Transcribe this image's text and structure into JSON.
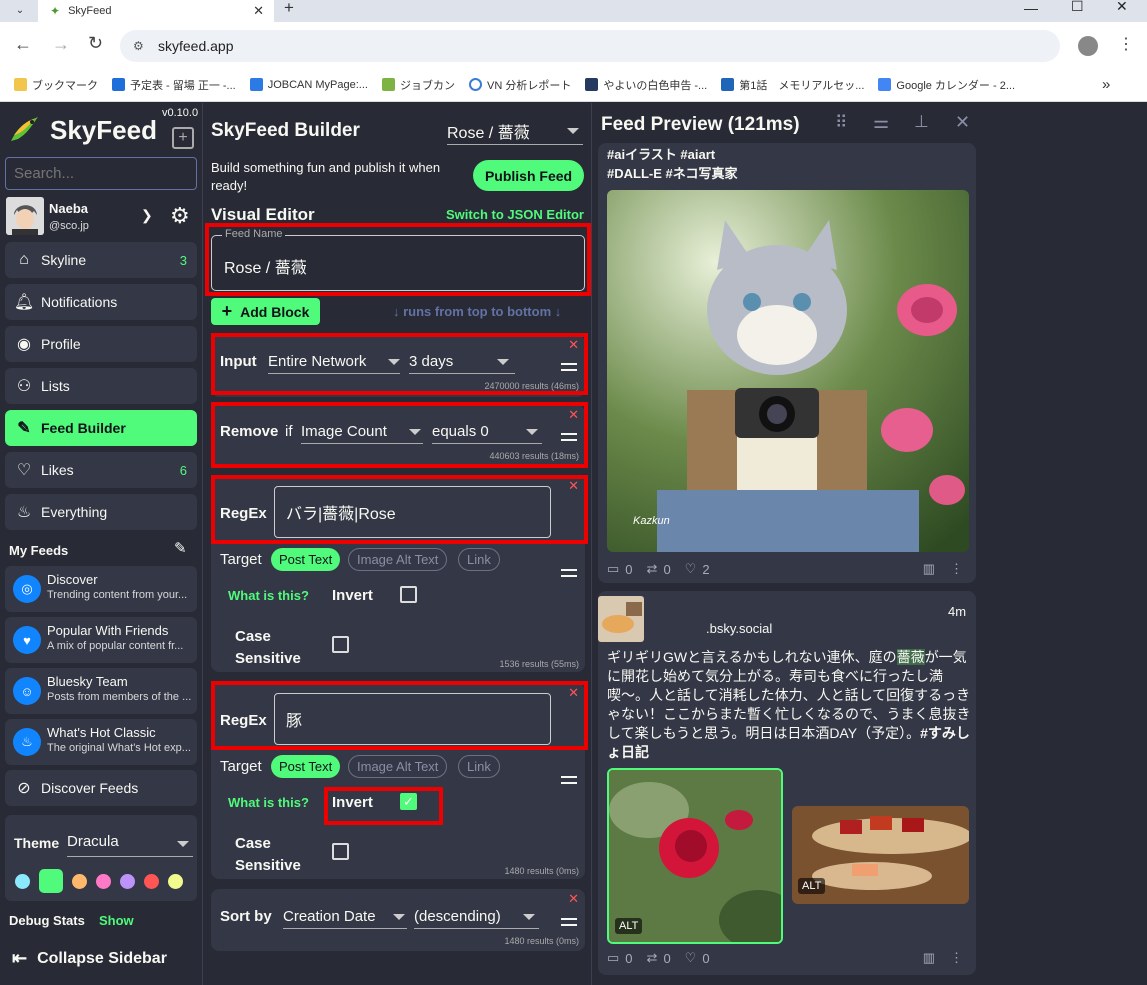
{
  "browser": {
    "tab_title": "SkyFeed",
    "url": "skyfeed.app",
    "bookmarks": [
      "ブックマーク",
      "予定表 - 留場 正一 -...",
      "JOBCAN MyPage:...",
      "ジョブカン",
      "VN 分析レポート",
      "やよいの白色申告 -...",
      "第1話　メモリアルセッ...",
      "Google カレンダー - 2..."
    ],
    "more": "»"
  },
  "sidebar": {
    "version": "v0.10.0",
    "brand": "SkyFeed",
    "search_placeholder": "Search...",
    "user_name": "Naeba",
    "user_handle": "@sco.jp",
    "nav": [
      {
        "label": "Skyline",
        "count": "3",
        "icon": "house-icon"
      },
      {
        "label": "Notifications",
        "count": "",
        "icon": "bell-icon"
      },
      {
        "label": "Profile",
        "count": "",
        "icon": "user-circle-icon"
      },
      {
        "label": "Lists",
        "count": "",
        "icon": "users-icon"
      },
      {
        "label": "Feed Builder",
        "count": "",
        "icon": "wrench-icon"
      },
      {
        "label": "Likes",
        "count": "6",
        "icon": "heart-icon"
      },
      {
        "label": "Everything",
        "count": "",
        "icon": "flame-icon"
      }
    ],
    "my_feeds_label": "My Feeds",
    "feeds": [
      {
        "title": "Discover",
        "desc": "Trending content from your..."
      },
      {
        "title": "Popular With Friends",
        "desc": "A mix of popular content fr..."
      },
      {
        "title": "Bluesky Team",
        "desc": "Posts from members of the ..."
      },
      {
        "title": "What's Hot Classic",
        "desc": "The original What's Hot exp..."
      }
    ],
    "discover_feeds": "Discover Feeds",
    "theme_label": "Theme",
    "theme_value": "Dracula",
    "theme_colors": [
      "#8be9fd",
      "#50fa7b",
      "#ffb86c",
      "#ff79c6",
      "#bd93f9",
      "#ff5555",
      "#f1fa8c"
    ],
    "debug_label": "Debug Stats",
    "debug_show": "Show",
    "collapse": "Collapse Sidebar"
  },
  "builder": {
    "title": "SkyFeed Builder",
    "feed_select": "Rose / 薔薇",
    "publish_desc": "Build something fun and publish it when ready!",
    "publish_button": "Publish Feed",
    "visual_editor": "Visual Editor",
    "switch_json": "Switch to JSON Editor",
    "feed_name_label": "Feed Name",
    "feed_name": "Rose / 薔薇",
    "add_block": "Add Block",
    "runs_hint": "↓ runs from top to bottom ↓",
    "input_block": {
      "label": "Input",
      "source": "Entire Network",
      "range": "3 days",
      "results": "2470000 results (46ms)"
    },
    "remove_block": {
      "label": "Remove",
      "if": "if",
      "field": "Image Count",
      "cond": "equals 0",
      "results": "440603 results (18ms)"
    },
    "regex1": {
      "label": "RegEx",
      "value": "バラ|薔薇|Rose",
      "target_label": "Target",
      "targets": [
        "Post Text",
        "Image Alt Text",
        "Link"
      ],
      "what": "What is this?",
      "invert": "Invert",
      "case": "Case Sensitive",
      "results": "1536 results (55ms)"
    },
    "regex2": {
      "label": "RegEx",
      "value": "豚",
      "target_label": "Target",
      "targets": [
        "Post Text",
        "Image Alt Text",
        "Link"
      ],
      "what": "What is this?",
      "invert": "Invert",
      "case": "Case Sensitive",
      "results": "1480 results (0ms)"
    },
    "sort_block": {
      "label": "Sort by",
      "field": "Creation Date",
      "order": "(descending)",
      "results": "1480 results (0ms)"
    }
  },
  "preview": {
    "title": "Feed Preview (121ms)",
    "post1": {
      "tags1": "#aiイラスト #aiart",
      "tags2": "#DALL-E #ネコ写真家",
      "signature": "Kazkun",
      "replies": "0",
      "reposts": "0",
      "likes": "2"
    },
    "post2": {
      "handle": ".bsky.social",
      "time": "4m",
      "text_before": "ギリギリGWと言えるかもしれない連休、庭の",
      "text_highlight": "薔薇",
      "text_after": "が一気に開花し始めて気分上がる。寿司も食べに行ったし満喫〜。人と話して消耗した体力、人と話して回復するっきゃない！ここからまた暫く忙しくなるので、うまく息抜きして楽しもうと思う。明日は日本酒DAY（予定）。",
      "tag": "#すみしょ日記",
      "alt1": "ALT",
      "alt2": "ALT",
      "replies": "0",
      "reposts": "0",
      "likes": "0"
    }
  }
}
